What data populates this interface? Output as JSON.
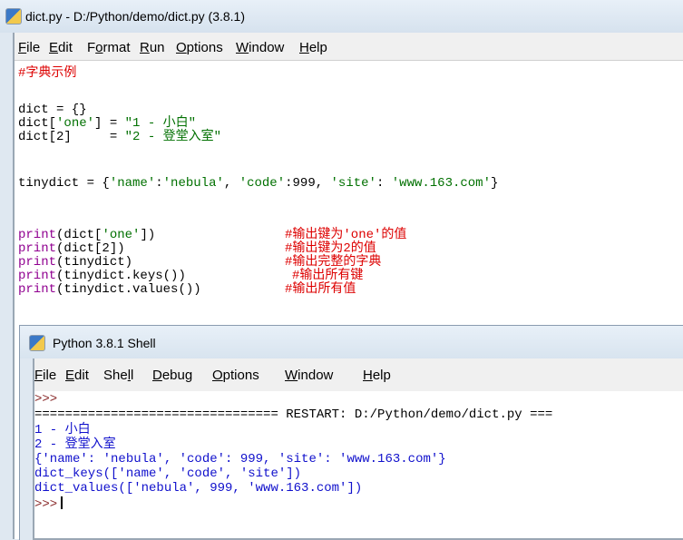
{
  "editor": {
    "title": "dict.py - D:/Python/demo/dict.py (3.8.1)",
    "menu": [
      {
        "pre": "",
        "u": "F",
        "post": "ile"
      },
      {
        "pre": "",
        "u": "E",
        "post": "dit"
      },
      {
        "pre": "F",
        "u": "o",
        "post": "rmat"
      },
      {
        "pre": "",
        "u": "R",
        "post": "un"
      },
      {
        "pre": "",
        "u": "O",
        "post": "ptions"
      },
      {
        "pre": "",
        "u": "W",
        "post": "indow"
      },
      {
        "pre": "",
        "u": "H",
        "post": "elp"
      }
    ],
    "code": {
      "comment_header": "#字典示例",
      "line_dict_empty": "dict = {}",
      "line_dict_one_a": "dict[",
      "line_dict_one_key": "'one'",
      "line_dict_one_b": "] = ",
      "line_dict_one_val": "\"1 - 小白\"",
      "line_dict_two_a": "dict[2]     = ",
      "line_dict_two_val": "\"2 - 登堂入室\"",
      "tiny_a": "tinydict = {",
      "tiny_k1": "'name'",
      "tiny_c1": ":",
      "tiny_v1": "'nebula'",
      "tiny_sep1": ", ",
      "tiny_k2": "'code'",
      "tiny_c2": ":999, ",
      "tiny_k3": "'site'",
      "tiny_c3": ": ",
      "tiny_v3": "'www.163.com'",
      "tiny_end": "}",
      "p1_a": "print",
      "p1_b": "(dict[",
      "p1_key": "'one'",
      "p1_c": "])",
      "p1_cmt": "#输出键为'one'的值",
      "p2_a": "print",
      "p2_b": "(dict[2])",
      "p2_cmt": "#输出键为2的值",
      "p3_a": "print",
      "p3_b": "(tinydict)",
      "p3_cmt": "#输出完整的字典",
      "p4_a": "print",
      "p4_b": "(tinydict.keys())",
      "p4_cmt": "#输出所有键",
      "p5_a": "print",
      "p5_b": "(tinydict.values())",
      "p5_cmt": "#输出所有值"
    }
  },
  "shell": {
    "title": "Python 3.8.1 Shell",
    "menu": [
      {
        "pre": "",
        "u": "F",
        "post": "ile"
      },
      {
        "pre": "",
        "u": "E",
        "post": "dit"
      },
      {
        "pre": "She",
        "u": "l",
        "post": "l"
      },
      {
        "pre": "",
        "u": "D",
        "post": "ebug"
      },
      {
        "pre": "",
        "u": "O",
        "post": "ptions"
      },
      {
        "pre": "",
        "u": "W",
        "post": "indow"
      },
      {
        "pre": "",
        "u": "H",
        "post": "elp"
      }
    ],
    "prompt": ">>>",
    "restart": "================================ RESTART: D:/Python/demo/dict.py ===",
    "out1": "1 - 小白",
    "out2": "2 - 登堂入室",
    "out3": "{'name': 'nebula', 'code': 999, 'site': 'www.163.com'}",
    "out4": "dict_keys(['name', 'code', 'site'])",
    "out5": "dict_values(['nebula', 999, 'www.163.com'])",
    "prompt_last": ">>>"
  },
  "colors": {
    "keyword": "#900090",
    "string": "#007000",
    "comment": "#dd0000",
    "output": "#1010cc"
  }
}
